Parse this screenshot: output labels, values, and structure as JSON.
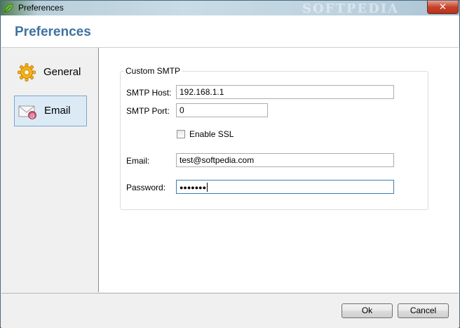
{
  "window": {
    "title": "Preferences",
    "close_glyph": "✕",
    "watermark": "SOFTPEDIA"
  },
  "header": {
    "title": "Preferences"
  },
  "sidebar": {
    "items": [
      {
        "label": "General",
        "icon": "gear-icon",
        "selected": false
      },
      {
        "label": "Email",
        "icon": "email-icon",
        "selected": true
      }
    ]
  },
  "email": {
    "group_label": "Custom SMTP",
    "smtp_host_label": "SMTP Host:",
    "smtp_host_value": "192.168.1.1",
    "smtp_port_label": "SMTP Port:",
    "smtp_port_value": "0",
    "ssl_label": "Enable SSL",
    "ssl_checked": false,
    "email_label": "Email:",
    "email_value": "test@softpedia.com",
    "password_label": "Password:",
    "password_value": "●●●●●●●"
  },
  "footer": {
    "ok_label": "Ok",
    "cancel_label": "Cancel"
  },
  "colors": {
    "title_blue": "#3f72a0",
    "selection_bg": "#dceaf6",
    "selection_border": "#7aa7cf",
    "close_red": "#c5442d"
  }
}
